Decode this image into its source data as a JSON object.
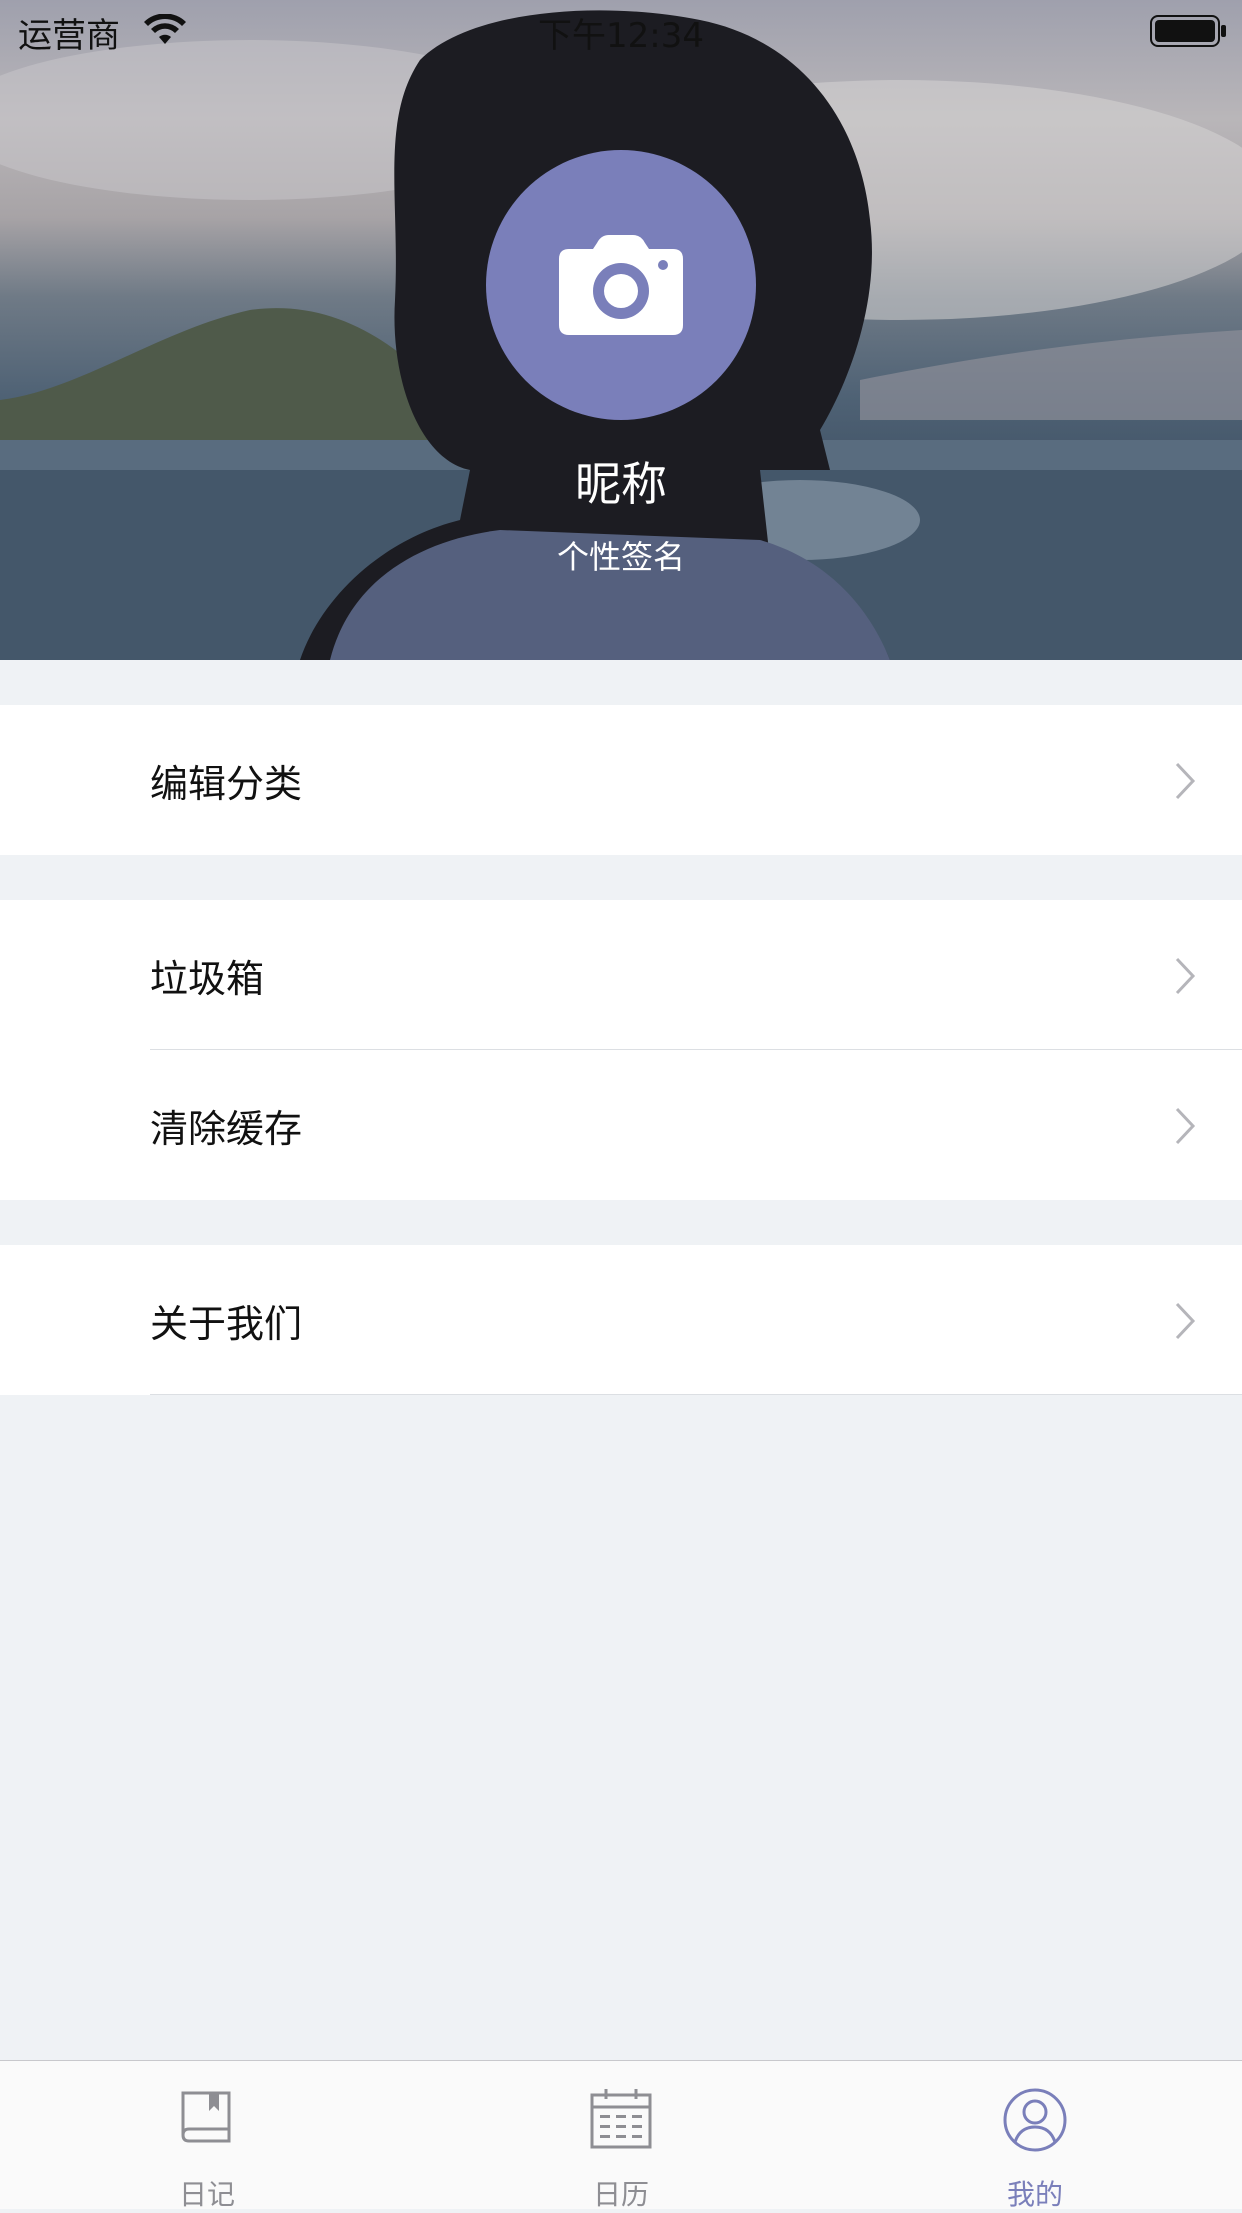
{
  "status_bar": {
    "carrier": "运营商",
    "time": "下午12:34"
  },
  "profile": {
    "nickname": "昵称",
    "signature": "个性签名",
    "avatar_icon": "camera-icon",
    "avatar_color": "#7a7fba"
  },
  "menu": {
    "edit_category": "编辑分类",
    "trash": "垃圾箱",
    "clear_cache": "清除缓存",
    "about_us": "关于我们"
  },
  "tabs": [
    {
      "label": "日记",
      "icon": "book-icon",
      "active": false
    },
    {
      "label": "日历",
      "icon": "calendar-icon",
      "active": false
    },
    {
      "label": "我的",
      "icon": "user-icon",
      "active": true
    }
  ],
  "colors": {
    "accent": "#7a7fba",
    "background": "#eff2f5",
    "inactive_tab": "#8e8e93"
  }
}
